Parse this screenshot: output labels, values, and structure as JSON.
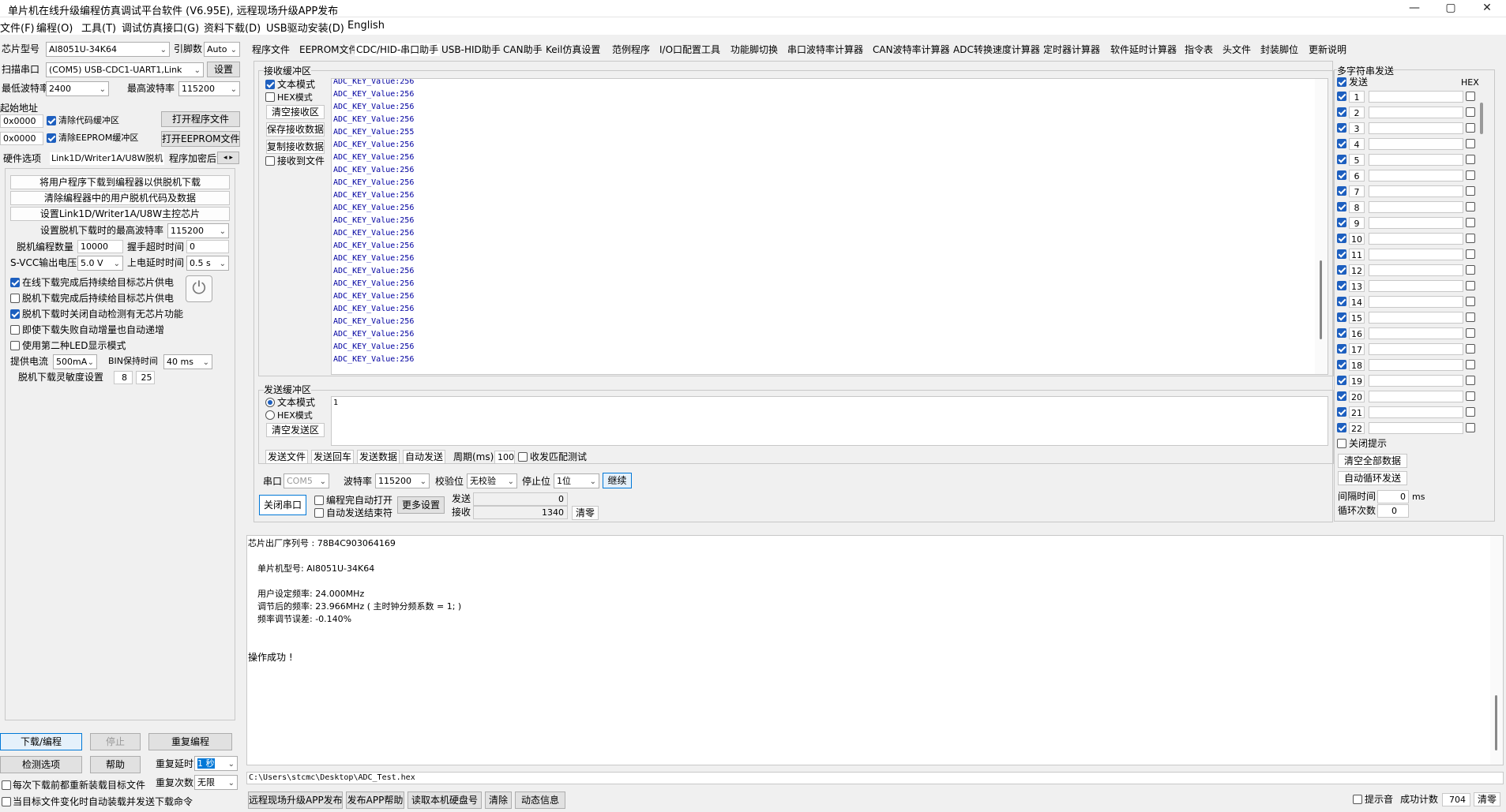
{
  "window": {
    "title": "单片机在线升级编程仿真调试平台软件 (V6.95E), 远程现场升级APP发布",
    "min": "—",
    "max": "▢",
    "close": "✕"
  },
  "menu": [
    "文件(F)",
    "编程(O)",
    "工具(T)",
    "调试仿真接口(G)",
    "资料下载(D)",
    "USB驱动安装(D)",
    "English"
  ],
  "left": {
    "chip_label": "芯片型号",
    "chip_value": "AI8051U-34K64",
    "pin_label": "引脚数",
    "pin_value": "Auto",
    "scan_label": "扫描串口",
    "port_value": "(COM5) USB-CDC1-UART1,Link",
    "settings_btn": "设置",
    "min_baud_label": "最低波特率",
    "min_baud_value": "2400",
    "max_baud_label": "最高波特率",
    "max_baud_value": "115200",
    "start_addr_label": "起始地址",
    "addr1": "0x0000",
    "clear_code_label": "清除代码缓冲区",
    "open_prog_btn": "打开程序文件",
    "addr2": "0x0000",
    "clear_eeprom_label": "清除EEPROM缓冲区",
    "open_eeprom_btn": "打开EEPROM文件",
    "subtabs": [
      "硬件选项",
      "Link1D/Writer1A/U8W脱机",
      "程序加密后"
    ],
    "offline_btns": [
      "将用户程序下载到编程器以供脱机下载",
      "清除编程器中的用户脱机代码及数据",
      "设置Link1D/Writer1A/U8W主控芯片"
    ],
    "offline_max_baud_label": "设置脱机下载时的最高波特率",
    "offline_max_baud_value": "115200",
    "offline_count_label": "脱机编程数量",
    "offline_count_value": "10000",
    "handshake_label": "握手超时时间",
    "handshake_value": "0",
    "svcc_label": "S-VCC输出电压",
    "svcc_value": "5.0 V",
    "power_delay_label": "上电延时时间",
    "power_delay_value": "0.5 s",
    "options": [
      {
        "label": "在线下载完成后持续给目标芯片供电",
        "checked": true
      },
      {
        "label": "脱机下载完成后持续给目标芯片供电",
        "checked": false
      },
      {
        "label": "脱机下载时关闭自动检测有无芯片功能",
        "checked": true
      },
      {
        "label": "即使下载失败自动增量也自动递增",
        "checked": false
      },
      {
        "label": "使用第二种LED显示模式",
        "checked": false
      }
    ],
    "current_label": "提供电流",
    "current_value": "500mA",
    "bin_hold_label": "BIN保持时间",
    "bin_hold_value": "40 ms",
    "sensitivity_label": "脱机下载灵敏度设置",
    "sens1": "8",
    "sens2": "25",
    "download_btn": "下载/编程",
    "stop_btn": "停止",
    "reprog_btn": "重复编程",
    "check_btn": "检测选项",
    "help_btn": "帮助",
    "repeat_delay_label": "重复延时",
    "repeat_delay_value": "1 秒",
    "repeat_count_label": "重复次数",
    "repeat_count_value": "无限",
    "reload_label": "每次下载前都重新装载目标文件",
    "auto_load_label": "当目标文件变化时自动装载并发送下载命令"
  },
  "tabs": [
    "程序文件",
    "EEPROM文件",
    "CDC/HID-串口助手",
    "USB-HID助手",
    "CAN助手",
    "Keil仿真设置",
    "范例程序",
    "I/O口配置工具",
    "功能脚切换",
    "串口波特率计算器",
    "CAN波特率计算器",
    "ADC转换速度计算器",
    "定时器计算器",
    "软件延时计算器",
    "指令表",
    "头文件",
    "封装脚位",
    "更新说明"
  ],
  "recv": {
    "group_label": "接收缓冲区",
    "text_mode": "文本模式",
    "hex_mode": "HEX模式",
    "clear_btn": "清空接收区",
    "save_btn": "保存接收数据",
    "copy_btn": "复制接收数据",
    "to_file": "接收到文件",
    "lines": [
      "ADC_KEY_Value:256",
      "ADC_KEY_Value:256",
      "ADC_KEY_Value:256",
      "ADC_KEY_Value:256",
      "ADC_KEY_Value:255",
      "ADC_KEY_Value:256",
      "ADC_KEY_Value:256",
      "ADC_KEY_Value:256",
      "ADC_KEY_Value:256",
      "ADC_KEY_Value:256",
      "ADC_KEY_Value:256",
      "ADC_KEY_Value:256",
      "ADC_KEY_Value:256",
      "ADC_KEY_Value:256",
      "ADC_KEY_Value:256",
      "ADC_KEY_Value:256",
      "ADC_KEY_Value:256",
      "ADC_KEY_Value:256",
      "ADC_KEY_Value:256",
      "ADC_KEY_Value:256",
      "ADC_KEY_Value:256",
      "ADC_KEY_Value:256",
      "ADC_KEY_Value:256"
    ]
  },
  "send": {
    "group_label": "发送缓冲区",
    "text_mode": "文本模式",
    "hex_mode": "HEX模式",
    "clear_btn": "清空发送区",
    "content": "1",
    "send_file": "发送文件",
    "send_enter": "发送回车",
    "send_data": "发送数据",
    "auto_send": "自动发送",
    "period_label": "周期(ms)",
    "period_value": "100",
    "match_test": "收发匹配测试"
  },
  "serial": {
    "port_label": "串口",
    "port_value": "COM5",
    "baud_label": "波特率",
    "baud_value": "115200",
    "parity_label": "校验位",
    "parity_value": "无校验",
    "stop_label": "停止位",
    "stop_value": "1位",
    "continue_btn": "继续",
    "close_btn": "关闭串口",
    "auto_open": "编程完自动打开",
    "auto_end": "自动发送结束符",
    "more_btn": "更多设置",
    "tx_label": "发送",
    "tx_value": "0",
    "rx_label": "接收",
    "rx_value": "1340",
    "clear_btn": "清零"
  },
  "multi": {
    "group_label": "多字符串发送",
    "send_label": "发送",
    "hex_label": "HEX",
    "rows": [
      "1",
      "2",
      "3",
      "4",
      "5",
      "6",
      "7",
      "8",
      "9",
      "10",
      "11",
      "12",
      "13",
      "14",
      "15",
      "16",
      "17",
      "18",
      "19",
      "20",
      "21",
      "22"
    ],
    "close_tip": "关闭提示",
    "clear_all_btn": "清空全部数据",
    "auto_loop_btn": "自动循环发送",
    "interval_label": "间隔时间",
    "interval_value": "0",
    "interval_unit": "ms",
    "loop_label": "循环次数",
    "loop_value": "0"
  },
  "output": {
    "lines": [
      "芯片出厂序列号 : 78B4C903064169",
      "单片机型号: AI8051U-34K64",
      "用户设定频率: 24.000MHz",
      "调节后的频率: 23.966MHz ( 主时钟分频系数 = 1; )",
      "频率调节误差: -0.140%",
      "操作成功 !"
    ],
    "path": "C:\\Users\\stcmc\\Desktop\\ADC_Test.hex"
  },
  "bottom": {
    "btns": [
      "远程现场升级APP发布",
      "发布APP帮助",
      "读取本机硬盘号",
      "清除",
      "动态信息"
    ],
    "beep_label": "提示音",
    "success_label": "成功计数",
    "success_value": "704",
    "clear_btn": "清零"
  }
}
